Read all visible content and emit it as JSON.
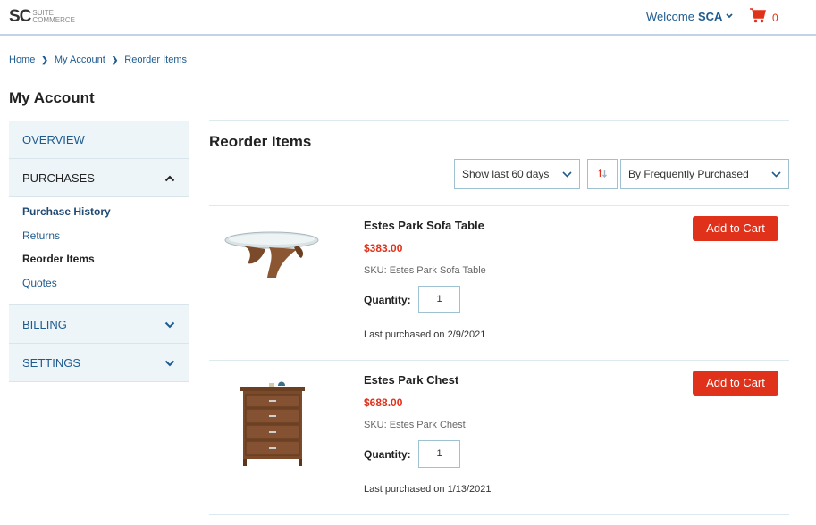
{
  "header": {
    "logo_sc": "SC",
    "logo_line1": "SUITE",
    "logo_line2": "COMMERCE",
    "welcome_label": "Welcome",
    "user_name": "SCA",
    "cart_count": "0"
  },
  "breadcrumb": [
    "Home",
    "My Account",
    "Reorder Items"
  ],
  "page_title": "My Account",
  "sidebar": {
    "overview": "OVERVIEW",
    "purchases": "PURCHASES",
    "purchases_items": [
      "Purchase History",
      "Returns",
      "Reorder Items",
      "Quotes"
    ],
    "billing": "BILLING",
    "settings": "SETTINGS"
  },
  "main": {
    "title": "Reorder Items",
    "filter_value": "Show last 60 days",
    "sort_value": "By Frequently Purchased",
    "qty_label": "Quantity:",
    "add_label": "Add to Cart",
    "items": [
      {
        "name": "Estes Park Sofa Table",
        "price": "$383.00",
        "sku": "SKU: Estes Park Sofa Table",
        "qty": "1",
        "last": "Last purchased on 2/9/2021"
      },
      {
        "name": "Estes Park Chest",
        "price": "$688.00",
        "sku": "SKU: Estes Park Chest",
        "qty": "1",
        "last": "Last purchased on 1/13/2021"
      }
    ]
  },
  "colors": {
    "accent": "#e0321b",
    "link": "#1f5b8f",
    "sidebar_bg": "#edf5f8"
  }
}
